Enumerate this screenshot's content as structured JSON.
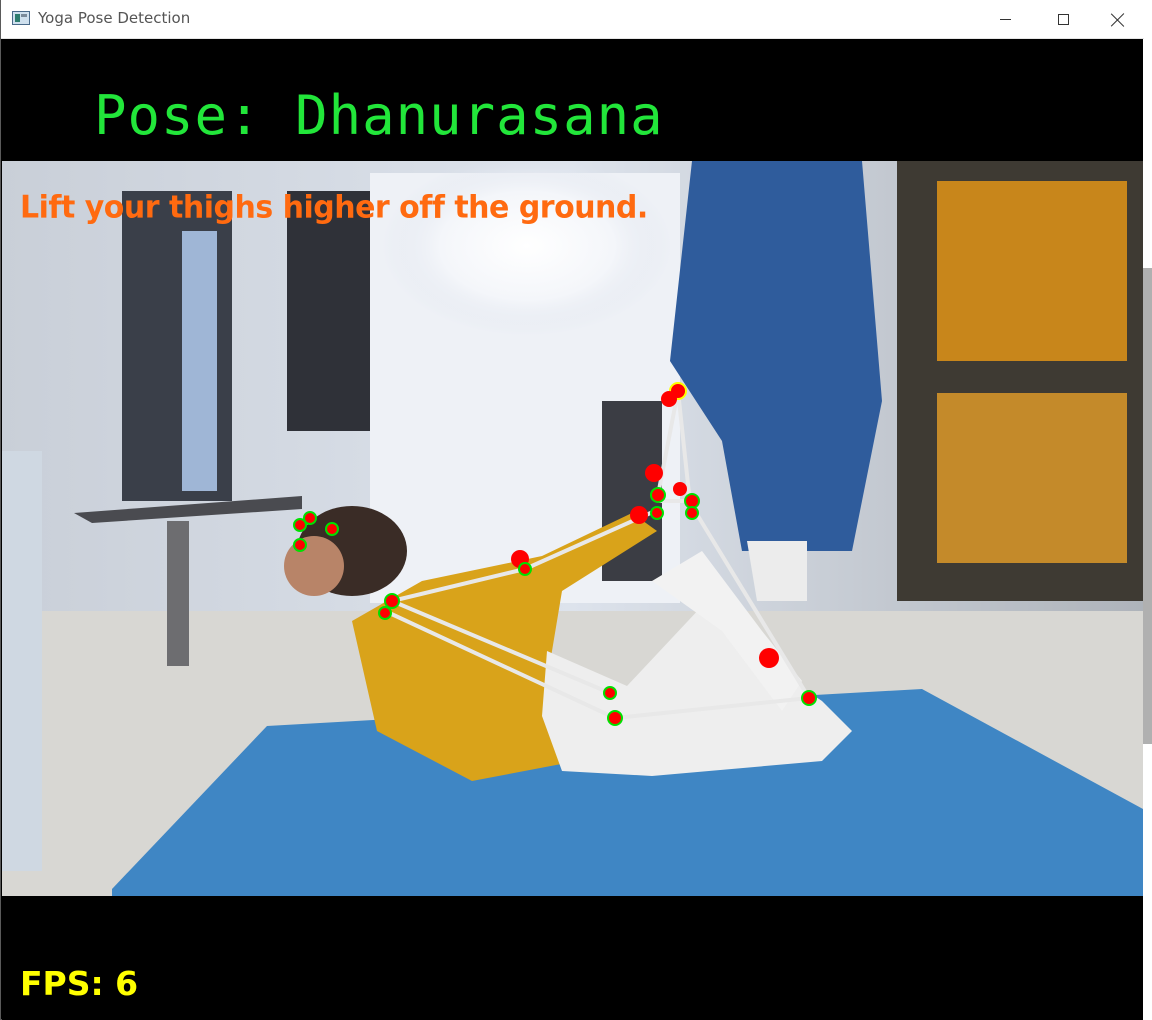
{
  "window": {
    "title": "Yoga Pose Detection",
    "controls": {
      "minimize": "minimize",
      "maximize": "maximize",
      "close": "close"
    }
  },
  "overlay": {
    "pose_label": "Pose: Dhanurasana",
    "feedback": "Lift your thighs higher off the ground.",
    "fps": "FPS: 6"
  },
  "colors": {
    "pose_label": "#22e63a",
    "feedback": "#ff6a10",
    "fps": "#ffff00",
    "landmark": "#ff0000",
    "landmark_ring": "#00e000",
    "skeleton_line": "#e8e8e8",
    "mat": "#3f86c4",
    "shirt": "#d9a31a"
  }
}
